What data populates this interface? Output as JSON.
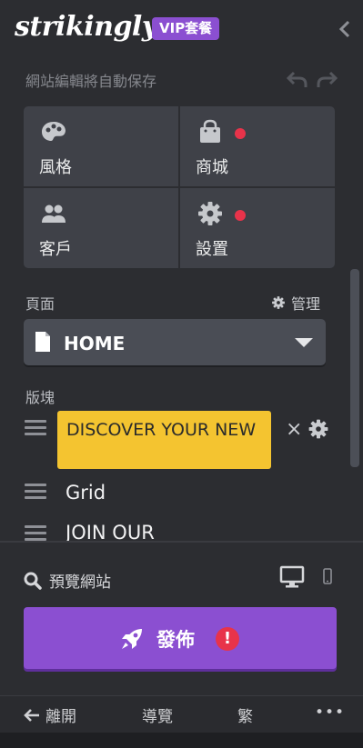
{
  "header": {
    "logo": "strikingly",
    "plan_badge": "VIP套餐",
    "autosave_status": "網站編輯將自動保存"
  },
  "tiles": [
    {
      "label": "風格",
      "icon": "palette-icon",
      "notification": false
    },
    {
      "label": "商城",
      "icon": "shopping-bag-icon",
      "notification": true
    },
    {
      "label": "客戶",
      "icon": "users-icon",
      "notification": false
    },
    {
      "label": "設置",
      "icon": "gear-icon",
      "notification": true
    }
  ],
  "pages": {
    "section_label": "頁面",
    "manage_label": "管理",
    "selected_page": "HOME"
  },
  "sections": {
    "section_label": "版塊",
    "items": [
      {
        "label": "DISCOVER YOUR NEW",
        "active": true
      },
      {
        "label": "Grid",
        "active": false
      },
      {
        "label": "JOIN OUR",
        "active": false
      }
    ],
    "close_symbol": "×"
  },
  "preview": {
    "label": "預覽網站"
  },
  "publish": {
    "label": "發佈",
    "alert_symbol": "!"
  },
  "footer": {
    "back_label": "離開",
    "tour_label": "導覽",
    "language_label": "繁",
    "more_label": "•••"
  },
  "colors": {
    "accent_purple": "#8b4fd1",
    "active_section": "#f4c430",
    "notification_red": "#e8334a",
    "panel_bg": "#2c2d31",
    "tile_bg": "#3f4148"
  }
}
